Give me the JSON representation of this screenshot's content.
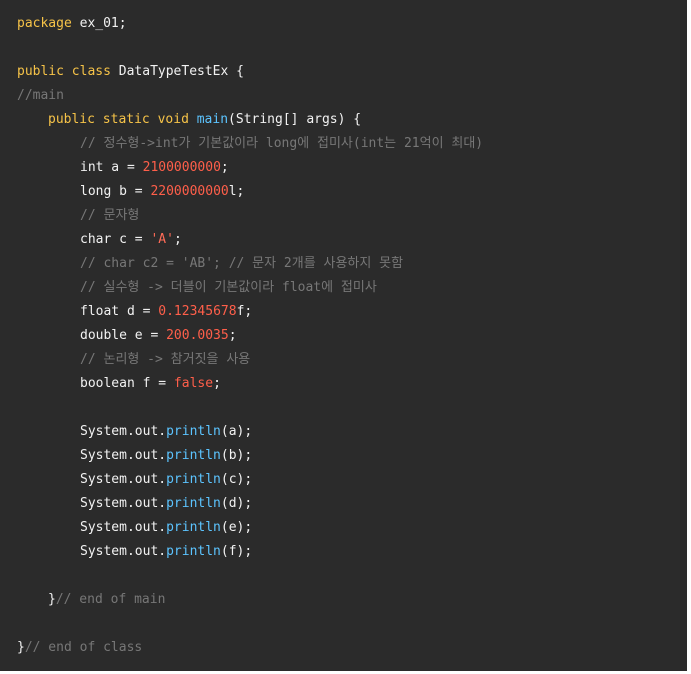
{
  "code": {
    "kw_package": "package",
    "package_name": " ex_01;",
    "kw_public": "public",
    "kw_class": "class",
    "class_decl": " DataTypeTestEx {",
    "comment_main": "//main",
    "kw_static": "static",
    "kw_void": "void",
    "main_fn": "main",
    "main_args": "(String[] args) {",
    "comment_int": "// 정수형->int가 기본값이라 long에 접미사(int는 21억이 최대)",
    "int_decl": "int a = ",
    "int_val": "2100000000",
    "semi": ";",
    "long_decl": "long b = ",
    "long_val": "2200000000",
    "long_suffix": "l;",
    "comment_char": "// 문자형",
    "char_decl": "char c = ",
    "char_val": "'A'",
    "comment_char2": "// char c2 = 'AB'; // 문자 2개를 사용하지 못함",
    "comment_float": "// 실수형 -> 더블이 기본값이라 float에 접미사",
    "float_decl": "float d = ",
    "float_val": "0.12345678",
    "float_suffix": "f;",
    "double_decl": "double e = ",
    "double_val": "200.0035",
    "comment_bool": "// 논리형 -> 참거짓을 사용",
    "bool_decl": "boolean f = ",
    "bool_val": "false",
    "sysout": "System.out.",
    "println": "println",
    "arg_a": "(a);",
    "arg_b": "(b);",
    "arg_c": "(c);",
    "arg_d": "(d);",
    "arg_e": "(e);",
    "arg_f": "(f);",
    "close_brace": "}",
    "comment_end_main": "// end of main",
    "comment_end_class": "// end of class"
  },
  "colors": {
    "background": "#2b2b2b",
    "keyword": "#f6c348",
    "function": "#5cc4ff",
    "number": "#ff5f4a",
    "comment": "#777777",
    "text": "#f2f2f2"
  }
}
